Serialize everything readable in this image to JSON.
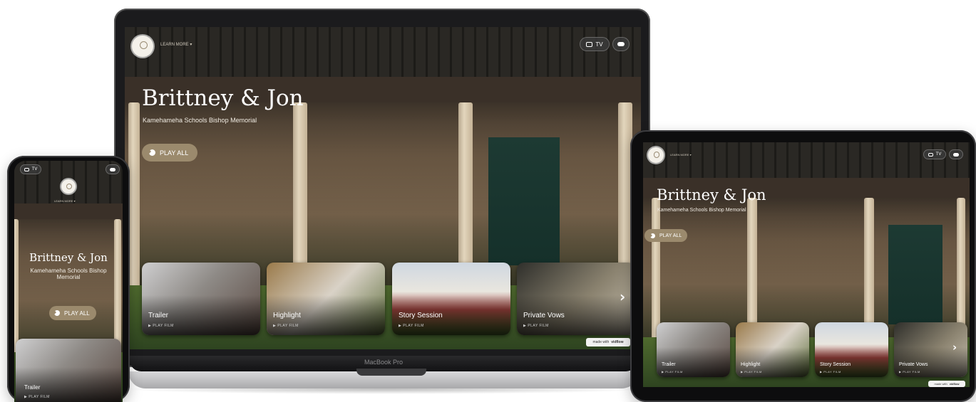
{
  "couple_title": "Brittney & Jon",
  "venue": "Kamehameha Schools Bishop Memorial",
  "learn_more_label": "LEARN MORE",
  "play_all_label": "PLAY ALL",
  "tv_label": "TV",
  "laptop_model_label": "MacBook Pro",
  "badge": {
    "prefix": "made with",
    "brand": "vidflow"
  },
  "film_cards": [
    {
      "title": "Trailer",
      "action": "PLAY FILM"
    },
    {
      "title": "Highlight",
      "action": "PLAY FILM"
    },
    {
      "title": "Story Session",
      "action": "PLAY FILM"
    },
    {
      "title": "Private Vows",
      "action": "PLAY FILM"
    }
  ],
  "icons": [
    "tv-icon",
    "cloud-download-icon",
    "play-circle-icon",
    "chevron-right-icon",
    "chevron-down-icon",
    "logo-seal"
  ],
  "colors": {
    "play_button": "#9b8a6d",
    "card_overlay": "#000000",
    "device_frame": "#1b1b1d"
  }
}
